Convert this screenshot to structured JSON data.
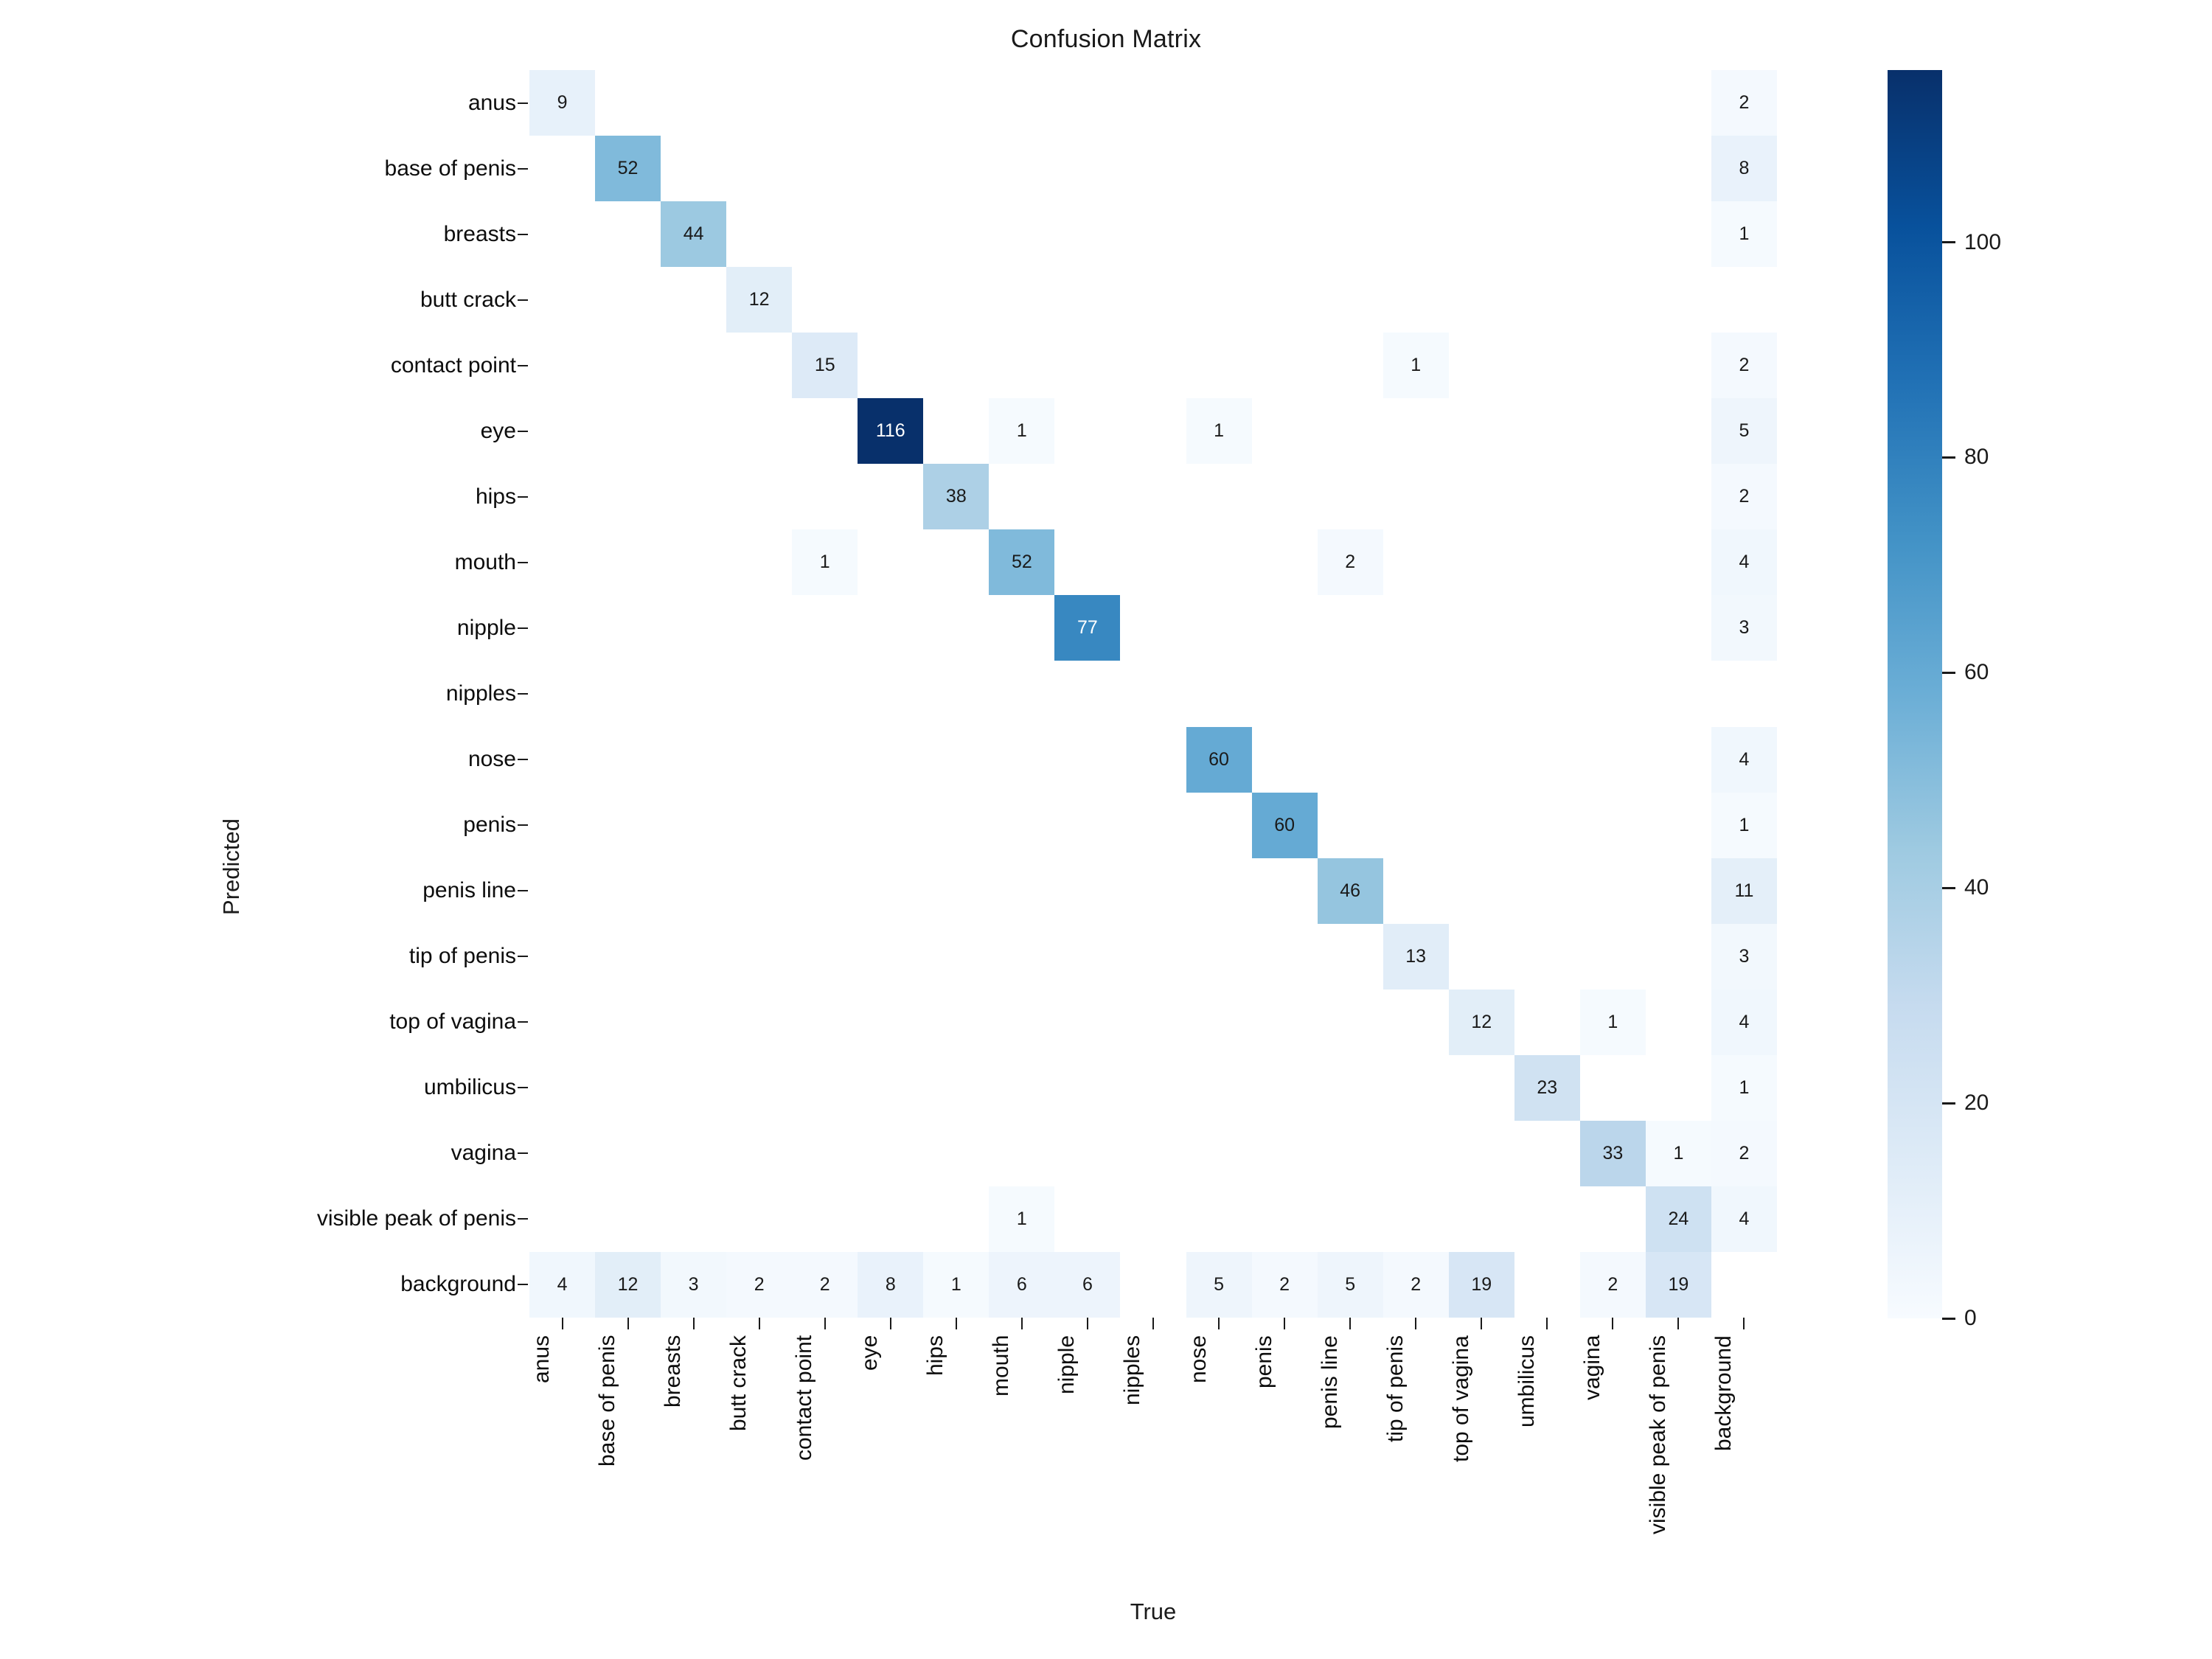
{
  "figure": {
    "title": "Confusion Matrix",
    "xlabel": "True",
    "ylabel": "Predicted"
  },
  "colors": {
    "cmap_low": "#f7fbff",
    "cmap_mid": "#6baed6",
    "cmap_high": "#08306b",
    "text_dark": "#1a1a1a",
    "text_light": "#ffffff",
    "background": "#ffffff"
  },
  "colorbar": {
    "ticks": [
      0,
      20,
      40,
      60,
      80,
      100
    ],
    "vmin": 0,
    "vmax": 116
  },
  "chart_data": {
    "type": "heatmap",
    "title": "Confusion Matrix",
    "xlabel": "True",
    "ylabel": "Predicted",
    "grid": false,
    "legend_position": "right",
    "vmin": 0,
    "vmax": 116,
    "colorbar_ticks": [
      0,
      20,
      40,
      60,
      80,
      100
    ],
    "x_categories": [
      "anus",
      "base of penis",
      "breasts",
      "butt crack",
      "contact point",
      "eye",
      "hips",
      "mouth",
      "nipple",
      "nipples",
      "nose",
      "penis",
      "penis line",
      "tip of penis",
      "top of vagina",
      "umbilicus",
      "vagina",
      "visible peak of penis",
      "background"
    ],
    "y_categories": [
      "anus",
      "base of penis",
      "breasts",
      "butt crack",
      "contact point",
      "eye",
      "hips",
      "mouth",
      "nipple",
      "nipples",
      "nose",
      "penis",
      "penis line",
      "tip of penis",
      "top of vagina",
      "umbilicus",
      "vagina",
      "visible peak of penis",
      "background"
    ],
    "values": [
      [
        9,
        0,
        0,
        0,
        0,
        0,
        0,
        0,
        0,
        0,
        0,
        0,
        0,
        0,
        0,
        0,
        0,
        0,
        2
      ],
      [
        0,
        52,
        0,
        0,
        0,
        0,
        0,
        0,
        0,
        0,
        0,
        0,
        0,
        0,
        0,
        0,
        0,
        0,
        8
      ],
      [
        0,
        0,
        44,
        0,
        0,
        0,
        0,
        0,
        0,
        0,
        0,
        0,
        0,
        0,
        0,
        0,
        0,
        0,
        1
      ],
      [
        0,
        0,
        0,
        12,
        0,
        0,
        0,
        0,
        0,
        0,
        0,
        0,
        0,
        0,
        0,
        0,
        0,
        0,
        0
      ],
      [
        0,
        0,
        0,
        0,
        15,
        0,
        0,
        0,
        0,
        0,
        0,
        0,
        0,
        1,
        0,
        0,
        0,
        0,
        2
      ],
      [
        0,
        0,
        0,
        0,
        0,
        116,
        0,
        1,
        0,
        0,
        1,
        0,
        0,
        0,
        0,
        0,
        0,
        0,
        5
      ],
      [
        0,
        0,
        0,
        0,
        0,
        0,
        38,
        0,
        0,
        0,
        0,
        0,
        0,
        0,
        0,
        0,
        0,
        0,
        2
      ],
      [
        0,
        0,
        0,
        0,
        1,
        0,
        0,
        52,
        0,
        0,
        0,
        0,
        2,
        0,
        0,
        0,
        0,
        0,
        4
      ],
      [
        0,
        0,
        0,
        0,
        0,
        0,
        0,
        0,
        77,
        0,
        0,
        0,
        0,
        0,
        0,
        0,
        0,
        0,
        3
      ],
      [
        0,
        0,
        0,
        0,
        0,
        0,
        0,
        0,
        0,
        0,
        0,
        0,
        0,
        0,
        0,
        0,
        0,
        0,
        0
      ],
      [
        0,
        0,
        0,
        0,
        0,
        0,
        0,
        0,
        0,
        0,
        60,
        0,
        0,
        0,
        0,
        0,
        0,
        0,
        4
      ],
      [
        0,
        0,
        0,
        0,
        0,
        0,
        0,
        0,
        0,
        0,
        0,
        60,
        0,
        0,
        0,
        0,
        0,
        0,
        1
      ],
      [
        0,
        0,
        0,
        0,
        0,
        0,
        0,
        0,
        0,
        0,
        0,
        0,
        46,
        0,
        0,
        0,
        0,
        0,
        11
      ],
      [
        0,
        0,
        0,
        0,
        0,
        0,
        0,
        0,
        0,
        0,
        0,
        0,
        0,
        13,
        0,
        0,
        0,
        0,
        3
      ],
      [
        0,
        0,
        0,
        0,
        0,
        0,
        0,
        0,
        0,
        0,
        0,
        0,
        0,
        0,
        12,
        0,
        1,
        0,
        4
      ],
      [
        0,
        0,
        0,
        0,
        0,
        0,
        0,
        0,
        0,
        0,
        0,
        0,
        0,
        0,
        0,
        23,
        0,
        0,
        1
      ],
      [
        0,
        0,
        0,
        0,
        0,
        0,
        0,
        0,
        0,
        0,
        0,
        0,
        0,
        0,
        0,
        0,
        33,
        1,
        2
      ],
      [
        0,
        0,
        0,
        0,
        0,
        0,
        0,
        1,
        0,
        0,
        0,
        0,
        0,
        0,
        0,
        0,
        0,
        24,
        4
      ],
      [
        4,
        12,
        3,
        2,
        2,
        8,
        1,
        6,
        6,
        0,
        5,
        2,
        5,
        2,
        19,
        0,
        2,
        19,
        0
      ]
    ]
  }
}
